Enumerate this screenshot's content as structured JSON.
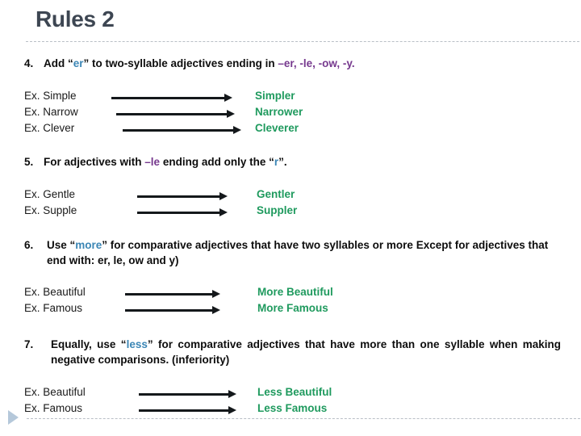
{
  "slide": {
    "title": "Rules 2",
    "colors": {
      "title": "#3d4652",
      "accent_blue": "#3b86b5",
      "accent_purple": "#76398e",
      "result_green": "#1f9a5e",
      "arrow": "#14181b",
      "divider": "#b9bfc6"
    }
  },
  "rules": [
    {
      "number": "4.",
      "text_before": "Add “",
      "highlight": "er",
      "text_after": "” to two-syllable adjectives ending in ",
      "endings": "–er, -le, -ow, -y.",
      "examples": [
        {
          "left": "Ex. Simple",
          "right": "Simpler"
        },
        {
          "left": "Ex.  Narrow",
          "right": "Narrower"
        },
        {
          "left": "Ex.  Clever",
          "right": "Cleverer"
        }
      ]
    },
    {
      "number": "5.",
      "text_before": "For adjectives with ",
      "highlight": "–le",
      "text_mid": " ending add only the “",
      "highlight2": "r",
      "text_after": "”.",
      "examples": [
        {
          "left": "Ex.  Gentle",
          "right": "Gentler"
        },
        {
          "left": "Ex.  Supple",
          "right": "Suppler"
        }
      ]
    },
    {
      "number": "6.",
      "text_before": "Use “",
      "highlight": "more",
      "text_after": "” for comparative adjectives that have two syllables or more Except for adjectives  that end with: er, le, ow and y)",
      "examples": [
        {
          "left": "Ex.  Beautiful",
          "right": "More Beautiful"
        },
        {
          "left": "Ex.  Famous",
          "right": "More Famous"
        }
      ]
    },
    {
      "number": "7.",
      "text_before": "Equally, use “",
      "highlight": "less",
      "text_after": "” for comparative adjectives that have more than one syllable when making negative comparisons. (inferiority)",
      "examples": [
        {
          "left": "Ex.  Beautiful",
          "right": "Less Beautiful"
        },
        {
          "left": "Ex.  Famous",
          "right": "Less Famous"
        }
      ]
    }
  ]
}
